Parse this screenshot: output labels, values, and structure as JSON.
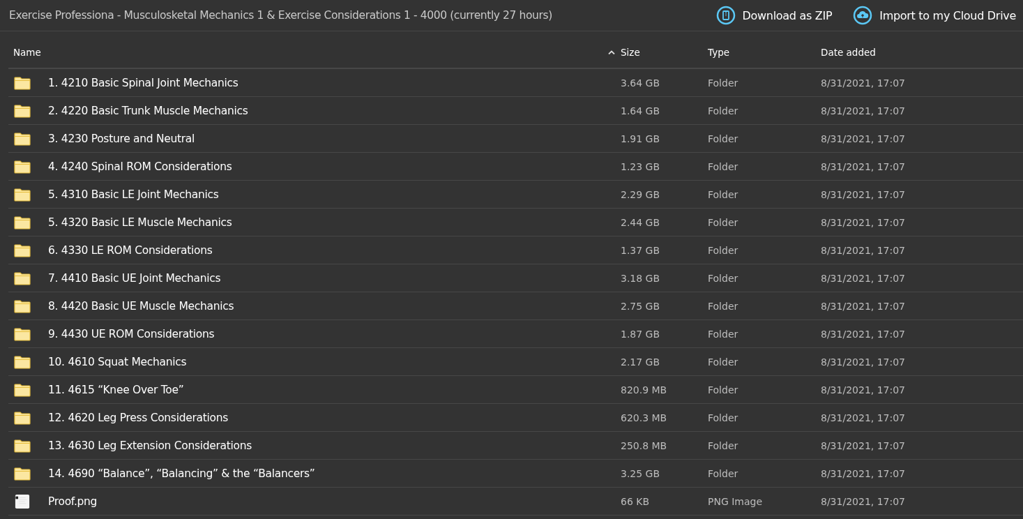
{
  "title": "Exercise Professiona - Musculosketal Mechanics 1 & Exercise Considerations 1 - 4000 (currently 27 hours)",
  "actions": [
    {
      "kind": "zip",
      "label": "Download as ZIP"
    },
    {
      "kind": "cloud",
      "label": "Import to my Cloud Drive"
    }
  ],
  "table": {
    "columns": [
      {
        "label": "Name",
        "sorted": true
      },
      {
        "label": "Size"
      },
      {
        "label": "Type"
      },
      {
        "label": "Date added"
      }
    ],
    "rows": [
      {
        "kind": "folder",
        "name": "1. 4210 Basic Spinal Joint Mechanics",
        "size": "3.64 GB",
        "type": "Folder",
        "date": "8/31/2021, 17:07"
      },
      {
        "kind": "folder",
        "name": "2. 4220 Basic Trunk Muscle Mechanics",
        "size": "1.64 GB",
        "type": "Folder",
        "date": "8/31/2021, 17:07"
      },
      {
        "kind": "folder",
        "name": "3. 4230 Posture and Neutral",
        "size": "1.91 GB",
        "type": "Folder",
        "date": "8/31/2021, 17:07"
      },
      {
        "kind": "folder",
        "name": "4. 4240 Spinal ROM Considerations",
        "size": "1.23 GB",
        "type": "Folder",
        "date": "8/31/2021, 17:07"
      },
      {
        "kind": "folder",
        "name": "5. 4310 Basic LE Joint Mechanics",
        "size": "2.29 GB",
        "type": "Folder",
        "date": "8/31/2021, 17:07"
      },
      {
        "kind": "folder",
        "name": "5. 4320 Basic LE Muscle Mechanics",
        "size": "2.44 GB",
        "type": "Folder",
        "date": "8/31/2021, 17:07"
      },
      {
        "kind": "folder",
        "name": "6. 4330 LE ROM Considerations",
        "size": "1.37 GB",
        "type": "Folder",
        "date": "8/31/2021, 17:07"
      },
      {
        "kind": "folder",
        "name": "7. 4410 Basic UE Joint Mechanics",
        "size": "3.18 GB",
        "type": "Folder",
        "date": "8/31/2021, 17:07"
      },
      {
        "kind": "folder",
        "name": "8. 4420 Basic UE Muscle Mechanics",
        "size": "2.75 GB",
        "type": "Folder",
        "date": "8/31/2021, 17:07"
      },
      {
        "kind": "folder",
        "name": "9. 4430 UE ROM Considerations",
        "size": "1.87 GB",
        "type": "Folder",
        "date": "8/31/2021, 17:07"
      },
      {
        "kind": "folder",
        "name": "10. 4610 Squat Mechanics",
        "size": "2.17 GB",
        "type": "Folder",
        "date": "8/31/2021, 17:07"
      },
      {
        "kind": "folder",
        "name": "11. 4615 “Knee Over Toe”",
        "size": "820.9 MB",
        "type": "Folder",
        "date": "8/31/2021, 17:07"
      },
      {
        "kind": "folder",
        "name": "12. 4620 Leg Press Considerations",
        "size": "620.3 MB",
        "type": "Folder",
        "date": "8/31/2021, 17:07"
      },
      {
        "kind": "folder",
        "name": "13. 4630 Leg Extension Considerations",
        "size": "250.8 MB",
        "type": "Folder",
        "date": "8/31/2021, 17:07"
      },
      {
        "kind": "folder",
        "name": "14. 4690 “Balance”, “Balancing” & the “Balancers”",
        "size": "3.25 GB",
        "type": "Folder",
        "date": "8/31/2021, 17:07"
      },
      {
        "kind": "image",
        "name": "Proof.png",
        "size": "66 KB",
        "type": "PNG Image",
        "date": "8/31/2021, 17:07"
      }
    ]
  }
}
